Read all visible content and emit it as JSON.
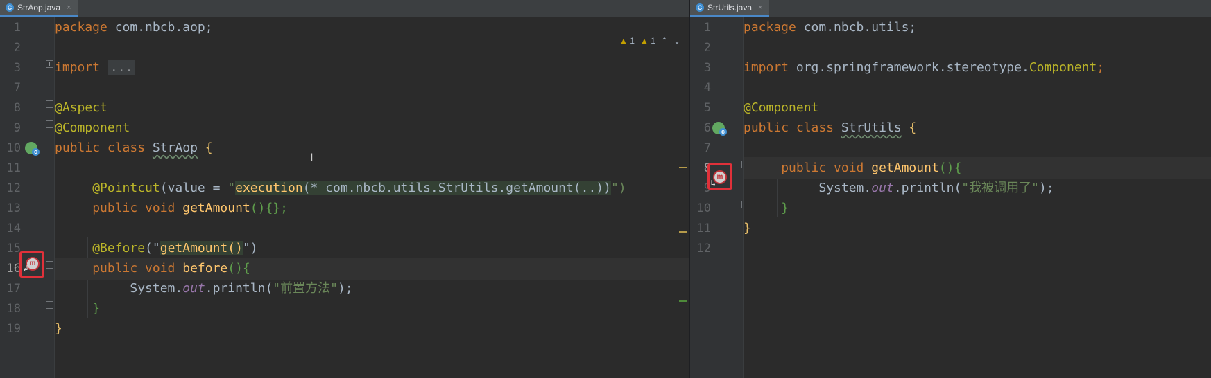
{
  "left": {
    "tab_label": "StrAop.java",
    "tab_icon": "C",
    "close_label": "×",
    "inspections": {
      "warnings": "1",
      "weak_warnings": "1"
    },
    "lines": {
      "n1": "1",
      "n2": "2",
      "n3": "3",
      "n7": "7",
      "n8": "8",
      "n9": "9",
      "n10": "10",
      "n11": "11",
      "n12": "12",
      "n13": "13",
      "n14": "14",
      "n15": "15",
      "n16": "16",
      "n17": "17",
      "n18": "18",
      "n19": "19"
    },
    "code": {
      "l1_kw": "package",
      "l1_rest": " com.nbcb.aop;",
      "l3_kw": "import",
      "l3_fold": "...",
      "l8": "@Aspect",
      "l9": "@Component",
      "l10_kw": "public class",
      "l10_name": "StrAop",
      "l10_brace": " {",
      "l12_ann": "@Pointcut",
      "l12_a": "(value = ",
      "l12_q1": "\"",
      "l12_exec": "execution",
      "l12_expr": "(* com.nbcb.utils.StrUtils.getAmount(..))",
      "l12_q2": "\")",
      "l13_kw": "public void",
      "l13_fn": "getAmount",
      "l13_rest": "(){};",
      "l15_ann": "@Before",
      "l15_a": "(\"",
      "l15_str": "getAmount()",
      "l15_b": "\")",
      "l16_kw": "public void",
      "l16_fn": "before",
      "l16_rest": "(){",
      "l17_a": "System.",
      "l17_field": "out",
      "l17_b": ".println(",
      "l17_str": "\"前置方法\"",
      "l17_c": ");",
      "l18": "}",
      "l19": "}"
    }
  },
  "right": {
    "tab_label": "StrUtils.java",
    "tab_icon": "C",
    "close_label": "×",
    "lines": {
      "n1": "1",
      "n2": "2",
      "n3": "3",
      "n4": "4",
      "n5": "5",
      "n6": "6",
      "n7": "7",
      "n8": "8",
      "n9": "9",
      "n10": "10",
      "n11": "11",
      "n12": "12"
    },
    "code": {
      "l1_kw": "package",
      "l1_rest": " com.nbcb.utils;",
      "l3_kw": "import",
      "l3_rest": " org.springframework.stereotype.",
      "l3_cls": "Component",
      "l3_end": ";",
      "l5": "@Component",
      "l6_kw": "public class",
      "l6_name": "StrUtils",
      "l6_brace": " {",
      "l8_kw": "public void",
      "l8_fn": "getAmount",
      "l8_rest": "(){",
      "l9_a": "System.",
      "l9_field": "out",
      "l9_b": ".println(",
      "l9_str": "\"我被调用了\"",
      "l9_c": ");",
      "l10": "}",
      "l11": "}"
    }
  },
  "colors": {
    "keyword": "#cc7832",
    "annotation": "#bbb529",
    "string": "#6a8759",
    "method": "#ffc66d",
    "field": "#9876aa",
    "highlight_box": "#e0313a"
  },
  "icons": [
    "class-file-icon",
    "spring-bean-icon",
    "aop-advice-icon",
    "fold-icon",
    "warning-icon",
    "chevron-up-icon",
    "chevron-down-icon",
    "text-cursor-icon"
  ]
}
